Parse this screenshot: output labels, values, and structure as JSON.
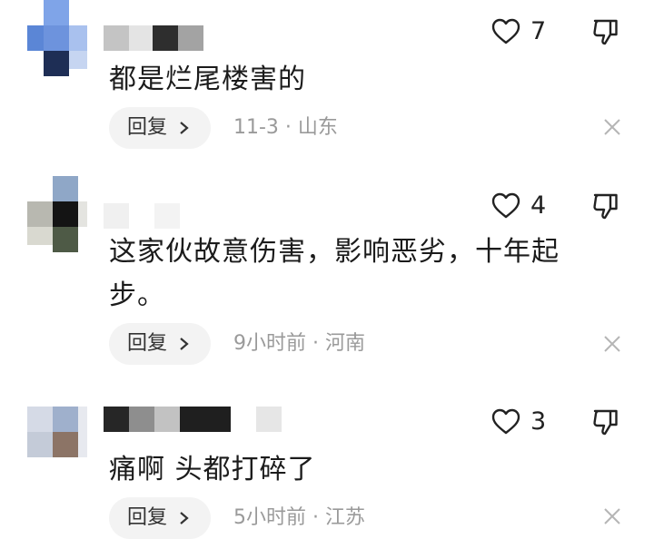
{
  "comments": [
    {
      "likes": "7",
      "text": "都是烂尾楼害的",
      "reply_label": "回复",
      "time": "11-3",
      "location": "山东",
      "meta": "11-3 · 山东"
    },
    {
      "likes": "4",
      "text": "这家伙故意伤害，影响恶劣，十年起步。",
      "reply_label": "回复",
      "time": "9小时前",
      "location": "河南",
      "meta": "9小时前 · 河南"
    },
    {
      "likes": "3",
      "text": "痛啊 头都打碎了",
      "reply_label": "回复",
      "time": "5小时前",
      "location": "江苏",
      "meta": "5小时前 · 江苏"
    }
  ],
  "icons": {
    "like": "heart-outline-icon",
    "dislike": "thumbs-down-outline-icon",
    "reply_chevron": "chevron-right-icon",
    "close": "close-icon"
  },
  "colors": {
    "background": "#ffffff",
    "text": "#1b1b1b",
    "meta_text": "#9a9a9a",
    "reply_bg": "#f3f3f3"
  }
}
